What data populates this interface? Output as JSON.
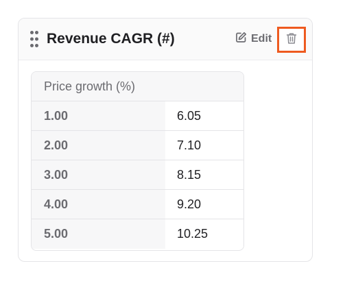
{
  "widget": {
    "title": "Revenue CAGR (#)",
    "edit_label": "Edit",
    "icons": {
      "drag": "drag-handle-icon",
      "edit": "pencil-square-icon",
      "delete": "trash-icon"
    },
    "colors": {
      "highlight": "#ee5a1f",
      "text": "#1f1f22",
      "muted": "#6b6b70"
    }
  },
  "table": {
    "header": "Price growth (%)",
    "rows": [
      {
        "key": "1.00",
        "value": "6.05"
      },
      {
        "key": "2.00",
        "value": "7.10"
      },
      {
        "key": "3.00",
        "value": "8.15"
      },
      {
        "key": "4.00",
        "value": "9.20"
      },
      {
        "key": "5.00",
        "value": "10.25"
      }
    ]
  }
}
